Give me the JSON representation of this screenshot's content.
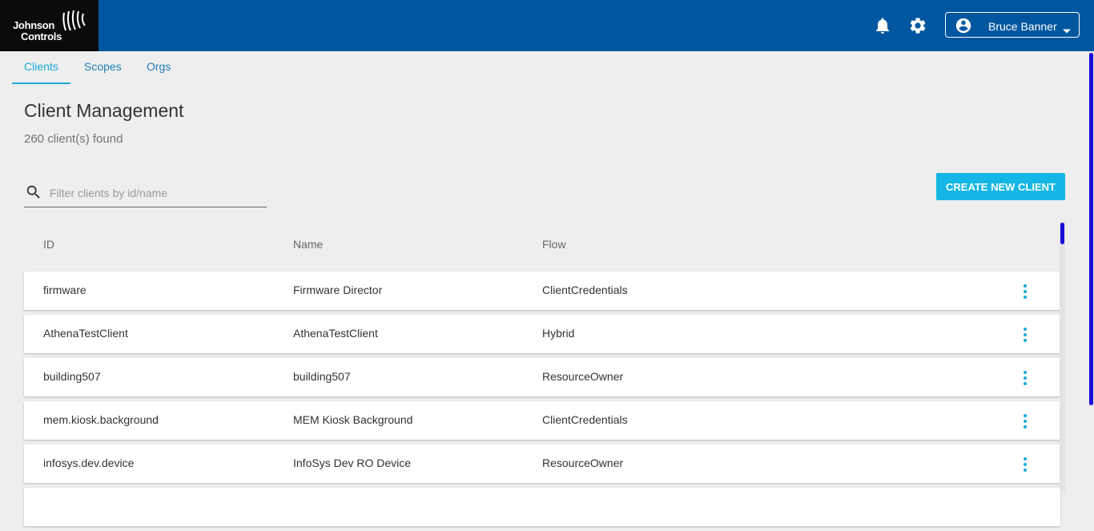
{
  "header": {
    "logo_line1": "Johnson",
    "logo_line2": "Controls",
    "user_name": "Bruce Banner",
    "icons": [
      "notifications-icon",
      "settings-icon",
      "account-circle-icon",
      "caret-down-icon"
    ]
  },
  "tabs": [
    {
      "label": "Clients",
      "active": true
    },
    {
      "label": "Scopes",
      "active": false
    },
    {
      "label": "Orgs",
      "active": false
    }
  ],
  "page": {
    "title": "Client Management",
    "count_text": "260 client(s) found"
  },
  "search": {
    "placeholder": "Filter clients by id/name",
    "value": ""
  },
  "create_button_label": "CREATE NEW CLIENT",
  "table": {
    "headers": [
      "ID",
      "Name",
      "Flow"
    ],
    "rows": [
      {
        "id": "firmware",
        "name": "Firmware Director",
        "flow": "ClientCredentials"
      },
      {
        "id": "AthenaTestClient",
        "name": "AthenaTestClient",
        "flow": "Hybrid"
      },
      {
        "id": "building507",
        "name": "building507",
        "flow": "ResourceOwner"
      },
      {
        "id": "mem.kiosk.background",
        "name": "MEM Kiosk Background",
        "flow": "ClientCredentials"
      },
      {
        "id": "infosys.dev.device",
        "name": "InfoSys Dev RO Device",
        "flow": "ResourceOwner"
      }
    ]
  },
  "colors": {
    "header_bg": "#0057a0",
    "logo_bg": "#0b0b0b",
    "accent": "#13b6e5",
    "kebab": "#19a9d6",
    "scroll_thumb": "#1a0dd8"
  }
}
